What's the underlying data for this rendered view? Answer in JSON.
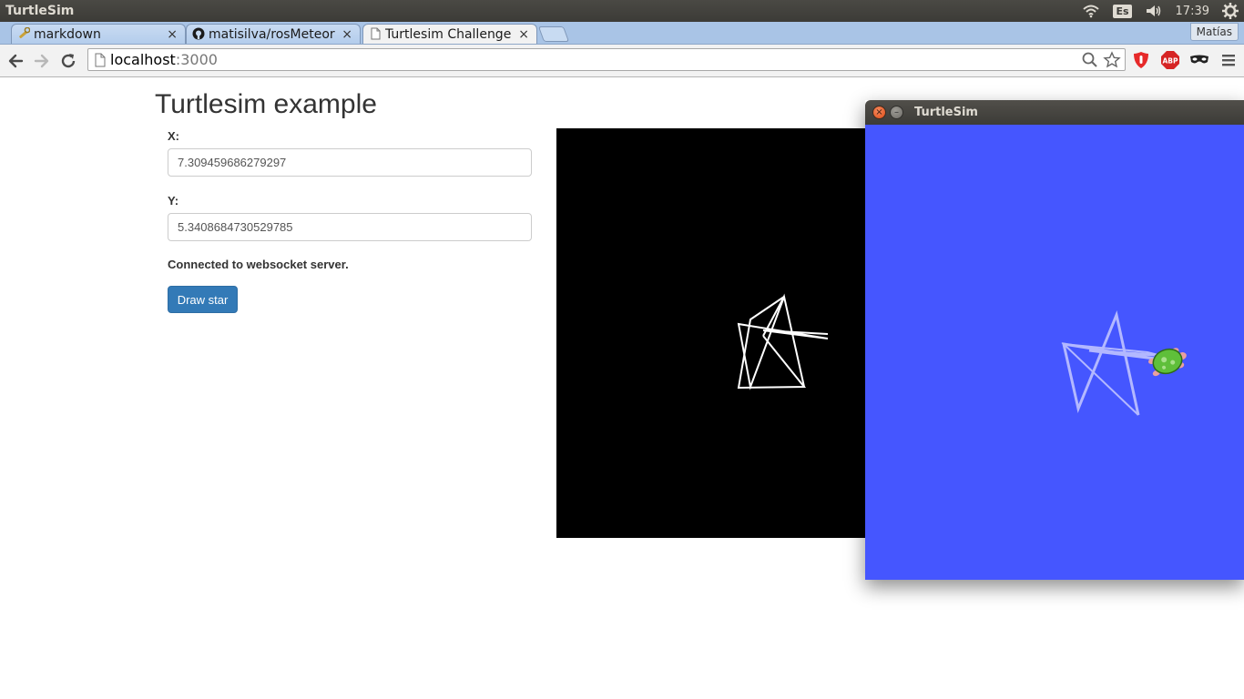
{
  "os_bar": {
    "title": "TurtleSim",
    "lang": "Es",
    "clock": "17:39"
  },
  "tabs": [
    {
      "label": "markdown",
      "close": "×",
      "icon": "wrench-icon"
    },
    {
      "label": "matisilva/rosMeteor",
      "close": "×",
      "icon": "github-icon"
    },
    {
      "label": "Turtlesim Challenge",
      "close": "×",
      "icon": "page-icon",
      "active": true
    }
  ],
  "profile_name": "Matías",
  "toolbar": {
    "url_host": "localhost",
    "url_port": ":3000",
    "abp_label": "ABP"
  },
  "page": {
    "title": "Turtlesim example",
    "x_label": "X:",
    "x_value": "7.309459686279297",
    "y_label": "Y:",
    "y_value": "5.3408684730529785",
    "status": "Connected to websocket server.",
    "draw_button": "Draw star"
  },
  "turtlesim_window": {
    "title": "TurtleSim",
    "close_glyph": "×",
    "min_glyph": "–"
  },
  "colors": {
    "os_bar": "#3c3b37",
    "tab_strip": "#a9c4e6",
    "primary_button": "#337ab7",
    "canvas_black": "#000000",
    "turtlesim_bg": "#4556ff",
    "star_white": "#ffffff",
    "star_trail": "#b3b8ff",
    "turtle_shell": "#5fbf3a"
  }
}
